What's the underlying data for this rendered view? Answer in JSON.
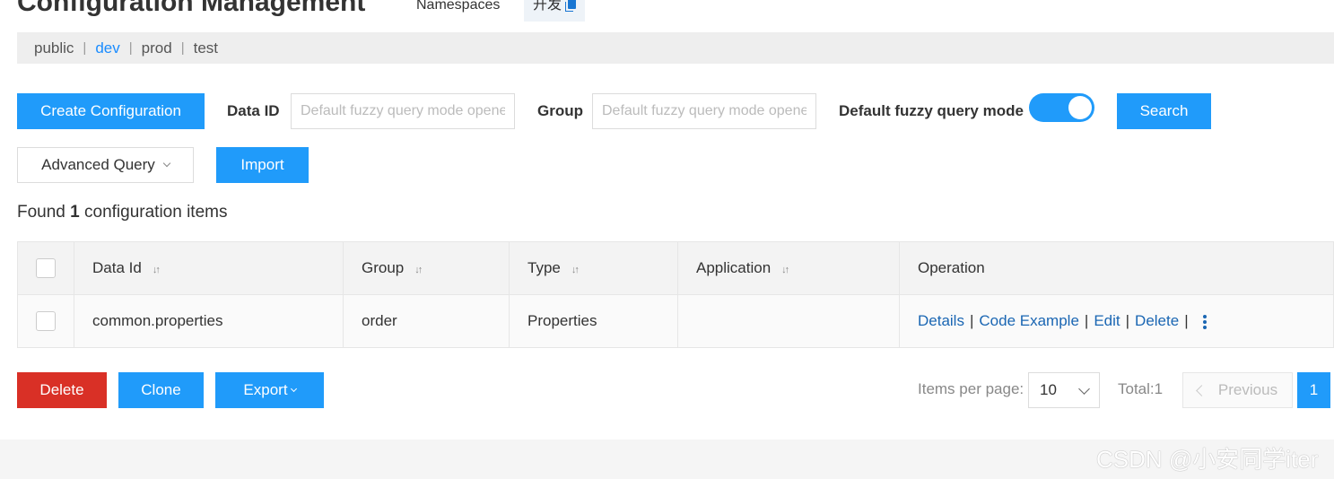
{
  "header": {
    "title": "Configuration Management",
    "namespaces_label": "Namespaces",
    "namespace_current": "开发"
  },
  "namespaces": {
    "items": [
      "public",
      "dev",
      "prod",
      "test"
    ],
    "separator": "|",
    "active": "dev"
  },
  "toolbar": {
    "create_label": "Create Configuration",
    "data_id_label": "Data ID",
    "data_id_placeholder": "Default fuzzy query mode opened",
    "group_label": "Group",
    "group_placeholder": "Default fuzzy query mode opened",
    "fuzzy_label": "Default fuzzy query mode",
    "fuzzy_enabled": true,
    "search_label": "Search",
    "advanced_label": "Advanced Query",
    "import_label": "Import"
  },
  "results": {
    "prefix": "Found",
    "count": "1",
    "suffix": "configuration items"
  },
  "table": {
    "columns": [
      "Data Id",
      "Group",
      "Type",
      "Application",
      "Operation"
    ],
    "rows": [
      {
        "data_id": "common.properties",
        "group": "order",
        "type": "Properties",
        "application": "",
        "operations": [
          "Details",
          "Code Example",
          "Edit",
          "Delete"
        ]
      }
    ]
  },
  "bottom": {
    "delete_label": "Delete",
    "clone_label": "Clone",
    "export_label": "Export"
  },
  "pagination": {
    "items_per_page_label": "Items per page:",
    "page_size": "10",
    "total": "Total:1",
    "previous_label": "Previous",
    "current_page": "1"
  },
  "watermark": "CSDN @小安同学iter",
  "colors": {
    "primary": "#209bfa",
    "danger": "#d93026",
    "link": "#1a66b3",
    "active_namespace": "#1a8cff"
  },
  "icons": [
    "copy-icon",
    "chevron-down-icon",
    "sort-icon",
    "more-vertical-icon",
    "chevron-left-icon"
  ]
}
